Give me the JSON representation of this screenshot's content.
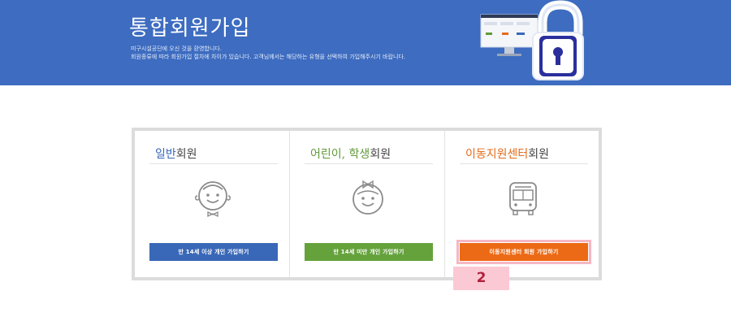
{
  "banner": {
    "title": "통합회원가입",
    "desc_line1": "미구시설공단에 오신 것을 환영합니다.",
    "desc_line2": "회원종류에 따라 회원가입 절차에 차이가 있습니다. 고객님께서는 해당하는 유형을 선택하여 가입해주시기 바랍니다."
  },
  "cards": [
    {
      "title_accent": "일반",
      "title_rest": "회원",
      "icon": "adult-face-icon",
      "button_label": "만 14세 이상 개인 가입하기"
    },
    {
      "title_accent": "어린이, 학생",
      "title_rest": "회원",
      "icon": "child-face-icon",
      "button_label": "만 14세 미만 개인 가입하기"
    },
    {
      "title_accent": "이동지원센터",
      "title_rest": "회원",
      "icon": "bus-icon",
      "button_label": "이동지원센터 회원 가입하기"
    }
  ],
  "step_badge": "2",
  "colors": {
    "banner": "#3d6cc0",
    "general": "#3a68b8",
    "child": "#65a23c",
    "mobility": "#ec6a15",
    "highlight": "#fbc9d3"
  }
}
